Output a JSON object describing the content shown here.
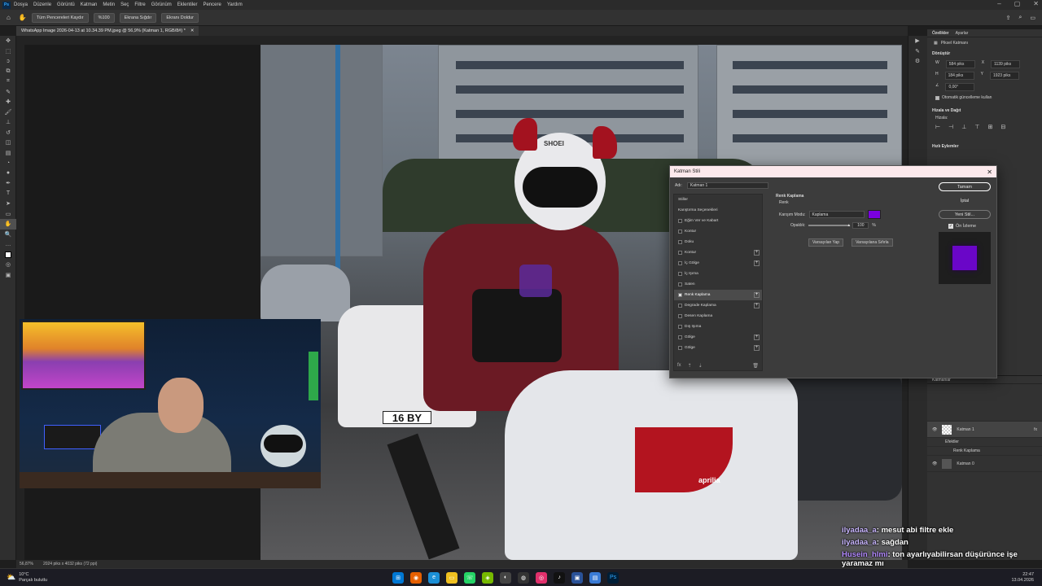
{
  "app": "Ps",
  "menu": [
    "Dosya",
    "Düzenle",
    "Görüntü",
    "Katman",
    "Metin",
    "Seç",
    "Filtre",
    "Görünüm",
    "Eklentiler",
    "Pencere",
    "Yardım"
  ],
  "options_bar": {
    "scroll_all": "Tüm Pencereleri Kaydır",
    "zoom": "%100",
    "fit_screen": "Ekrana Sığdır",
    "fill_screen": "Ekranı Doldur"
  },
  "doc_tab": "WhatsApp Image 2026-04-13 at 10.34.39 PM.jpeg @ 56,9% (Katman 1, RGB/8#) *",
  "status": {
    "zoom": "56,87%",
    "size": "2024 piks x 4032 piks (72 ppi)"
  },
  "properties": {
    "tabs": [
      "Özellikler",
      "Ayarlar"
    ],
    "layer_kind": "Piksel Katmanı",
    "transform_title": "Dönüştür",
    "w": "584 piks",
    "h": "184 piks",
    "x": "1139 piks",
    "y": "1923 piks",
    "angle": "0,00°",
    "auto_update": "Otomatik güncelleme kullan",
    "align_title": "Hizala ve Dağıt",
    "align_label": "Hizala:",
    "quick_actions": "Hızlı Eylemler"
  },
  "layers": {
    "title": "Katmanlar",
    "items": [
      {
        "name": "Katman 1"
      },
      {
        "name": "Efektler"
      },
      {
        "name": "Renk Kaplama"
      },
      {
        "name": "Katman 0"
      }
    ]
  },
  "dialog": {
    "title": "Katman Stili",
    "name_label": "Adı:",
    "name_value": "Katman 1",
    "effects": [
      {
        "label": "Stiller",
        "check": false,
        "plus": false
      },
      {
        "label": "Karıştırma Seçenekleri",
        "check": false,
        "plus": false
      },
      {
        "label": "Eğim Ver ve Kabart",
        "check": true,
        "plus": false
      },
      {
        "label": "Kontur",
        "check": true,
        "plus": false
      },
      {
        "label": "Doku",
        "check": true,
        "plus": false
      },
      {
        "label": "Kontur",
        "check": true,
        "plus": true
      },
      {
        "label": "İç Gölge",
        "check": true,
        "plus": true
      },
      {
        "label": "İç Işıma",
        "check": true,
        "plus": false
      },
      {
        "label": "Saten",
        "check": true,
        "plus": false
      },
      {
        "label": "Renk Kaplama",
        "check": true,
        "plus": true,
        "selected": true
      },
      {
        "label": "Degrade Kaplama",
        "check": true,
        "plus": true
      },
      {
        "label": "Desen Kaplama",
        "check": true,
        "plus": false
      },
      {
        "label": "Dış Işıma",
        "check": true,
        "plus": false
      },
      {
        "label": "Gölge",
        "check": true,
        "plus": true
      },
      {
        "label": "Gölge",
        "check": true,
        "plus": true
      }
    ],
    "section_title": "Renk Kaplama",
    "sub_title": "Renk",
    "blend_label": "Karışım Modu:",
    "blend_value": "Kaplama",
    "opacity_label": "Opaklık:",
    "opacity_value": "100",
    "opacity_unit": "%",
    "make_default": "Varsayılan Yap",
    "reset_default": "Varsayılana Sıfırla",
    "ok": "Tamam",
    "cancel": "İptal",
    "new_style": "Yeni Stil...",
    "preview_label": "Ön İzleme",
    "overlay_color": "#7a00e0"
  },
  "chat": [
    {
      "user": "ilyadaa_a",
      "text": ": mesut abi filtre ekle",
      "color": "#c9b6ff"
    },
    {
      "user": "ilyadaa_a",
      "text": ": sağdan",
      "color": "#c9b6ff"
    },
    {
      "user": "Husein_hlmi",
      "text": ": ton ayarlıyabilirsan düşürünce işe yaramaz mı",
      "color": "#b38aff"
    }
  ],
  "taskbar": {
    "weather_temp": "10°C",
    "weather_text": "Parçalı bulutlu",
    "time": "22:47",
    "date": "13.04.2026"
  },
  "photo": {
    "plate": "16 BY",
    "brand": "aprilia",
    "helmet": "SHOEI"
  }
}
